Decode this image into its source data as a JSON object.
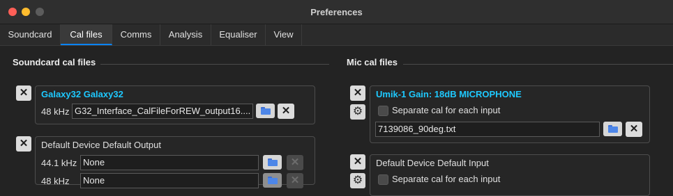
{
  "window": {
    "title": "Preferences"
  },
  "tabs": [
    {
      "label": "Soundcard"
    },
    {
      "label": "Cal files"
    },
    {
      "label": "Comms"
    },
    {
      "label": "Analysis"
    },
    {
      "label": "Equaliser"
    },
    {
      "label": "View"
    }
  ],
  "active_tab": "Cal files",
  "soundcard": {
    "title": "Soundcard cal files",
    "entries": [
      {
        "device": "Galaxy32 Galaxy32",
        "rate": "48 kHz",
        "file": "G32_Interface_CalFileForREW_output16...."
      },
      {
        "device": "Default Device Default Output",
        "rates": [
          {
            "rate": "44.1 kHz",
            "file": "None"
          },
          {
            "rate": "48 kHz",
            "file": "None"
          }
        ]
      }
    ]
  },
  "mic": {
    "title": "Mic cal files",
    "entries": [
      {
        "device": "Umik-1  Gain: 18dB MICROPHONE",
        "separate_label": "Separate cal for each input",
        "file": "7139086_90deg.txt"
      },
      {
        "device": "Default Device Default Input",
        "separate_label": "Separate cal for each input"
      }
    ]
  },
  "colors": {
    "accent": "#0a84ff",
    "device_name": "#1ec9ff",
    "background": "#232323"
  },
  "icons": {
    "remove": "close-icon",
    "browse": "folder-icon",
    "settings": "gear-icon"
  }
}
